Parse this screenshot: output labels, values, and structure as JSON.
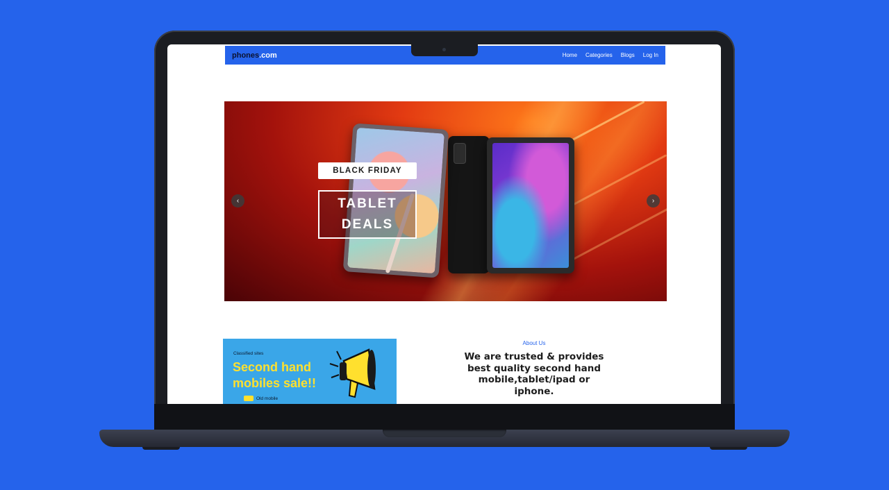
{
  "site": {
    "logo_main": "phones",
    "logo_tld": ".com",
    "nav": [
      {
        "label": "Home"
      },
      {
        "label": "Categories"
      },
      {
        "label": "Blogs"
      },
      {
        "label": "Log In"
      }
    ]
  },
  "hero": {
    "badge": "BLACK FRIDAY",
    "title_line1": "TABLET",
    "title_line2": "DEALS",
    "prev_arrow": "‹",
    "next_arrow": "›"
  },
  "promo": {
    "kicker": "Classified sites",
    "title_line1": "Second hand",
    "title_line2": "mobiles sale!!",
    "footer": "Old mobile"
  },
  "about": {
    "kicker": "About Us",
    "text": "We are trusted & provides best quality second hand mobile,tablet/ipad or iphone."
  },
  "colors": {
    "background": "#2563eb",
    "navbar": "#2563eb",
    "promo_bg": "#3aa6e8",
    "promo_title": "#ffe02e"
  }
}
